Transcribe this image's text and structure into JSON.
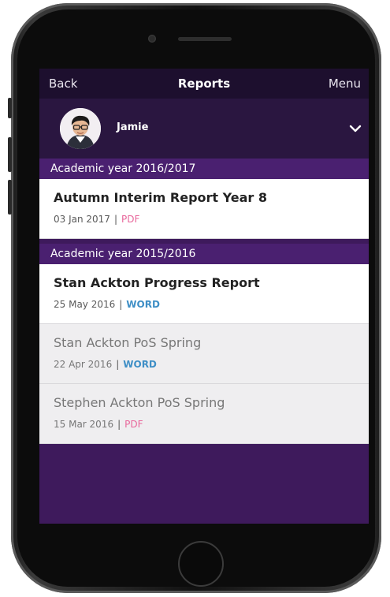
{
  "navbar": {
    "back_label": "Back",
    "title": "Reports",
    "menu_label": "Menu"
  },
  "profile": {
    "name": "Jamie"
  },
  "sections": [
    {
      "header": "Academic year 2016/2017",
      "reports": [
        {
          "title": "Autumn Interim Report Year 8",
          "date": "03 Jan 2017",
          "separator": "|",
          "type": "PDF",
          "state": "active"
        }
      ]
    },
    {
      "header": "Academic year 2015/2016",
      "reports": [
        {
          "title": "Stan Ackton Progress Report",
          "date": "25 May 2016",
          "separator": "|",
          "type": "WORD",
          "state": "active"
        },
        {
          "title": "Stan Ackton PoS Spring",
          "date": "22 Apr 2016",
          "separator": "|",
          "type": "WORD",
          "state": "muted"
        },
        {
          "title": "Stephen Ackton PoS Spring",
          "date": "15 Mar 2016",
          "separator": "|",
          "type": "PDF",
          "state": "muted"
        }
      ]
    }
  ],
  "colors": {
    "navbar": "#1d0f2e",
    "profile_bar": "#2a1640",
    "section_header": "#4a2070",
    "screen_background": "#3e1a5c",
    "pdf": "#e8679b",
    "word": "#3f8fc6"
  },
  "icons": {
    "expand": "chevron-down-icon",
    "avatar": "user-avatar"
  }
}
